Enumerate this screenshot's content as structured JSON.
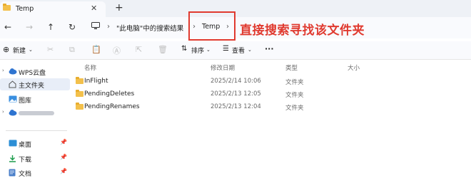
{
  "tab": {
    "title": "Temp",
    "close": "✕",
    "new_tab": "+"
  },
  "nav": {
    "back": "←",
    "forward": "→",
    "up": "↑",
    "refresh": "↻"
  },
  "breadcrumb": {
    "sep1": "›",
    "location": "\"此电脑\"中的搜索结果",
    "sep2": "›",
    "current": "Temp",
    "sep3": "›"
  },
  "annotation": "直接搜索寻找该文件夹",
  "toolbar": {
    "new_label": "新建",
    "sort_label": "排序",
    "view_label": "查看",
    "more": "···"
  },
  "sidebar": {
    "items": [
      {
        "label": "WPS云盘"
      },
      {
        "label": "主文件夹"
      },
      {
        "label": "图库"
      },
      {
        "label": ""
      },
      {
        "label": "桌面"
      },
      {
        "label": "下载"
      },
      {
        "label": "文档"
      }
    ]
  },
  "columns": {
    "name": "名称",
    "date": "修改日期",
    "type": "类型",
    "size": "大小"
  },
  "files": [
    {
      "name": "InFlight",
      "date": "2025/2/14 10:06",
      "type": "文件夹",
      "size": ""
    },
    {
      "name": "PendingDeletes",
      "date": "2025/2/13 12:05",
      "type": "文件夹",
      "size": ""
    },
    {
      "name": "PendingRenames",
      "date": "2025/2/13 12:04",
      "type": "文件夹",
      "size": ""
    }
  ],
  "colors": {
    "accent": "#0067c0",
    "annotation": "#e03a2f",
    "folder": "#f3c04b"
  }
}
